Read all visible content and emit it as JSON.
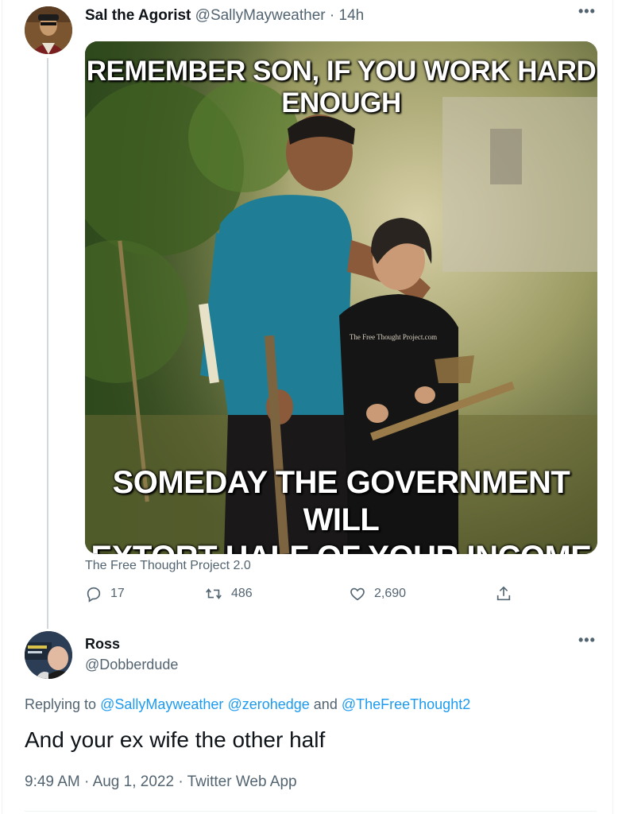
{
  "tweet1": {
    "display_name": "Sal the Agorist",
    "handle": "@SallyMayweather",
    "separator": "·",
    "time": "14h",
    "more": "•••",
    "meme_top_text": "REMEMBER SON, IF YOU WORK HARD ENOUGH",
    "meme_bottom_line1": "SOMEDAY THE GOVERNMENT WILL",
    "meme_bottom_line2": "EXTORT HALF OF YOUR INCOME",
    "shirt_text": "The Free Thought Project.com",
    "source": "The Free Thought Project 2.0",
    "actions": {
      "replies": "17",
      "retweets": "486",
      "likes": "2,690"
    }
  },
  "tweet2": {
    "display_name": "Ross",
    "handle": "@Dobberdude",
    "more": "•••",
    "replying_prefix": "Replying to",
    "mention1": "@SallyMayweather",
    "mention2": "@zerohedge",
    "and_word": "and",
    "mention3": "@TheFreeThought2",
    "text": "And your ex wife the other half",
    "timestamp": "9:49 AM",
    "dot1": "·",
    "date": "Aug 1, 2022",
    "dot2": "·",
    "app": "Twitter Web App"
  },
  "colors": {
    "link": "#1d9bf0",
    "secondary_text": "#536471",
    "primary_text": "#0f1419",
    "divider": "#eff3f4"
  }
}
